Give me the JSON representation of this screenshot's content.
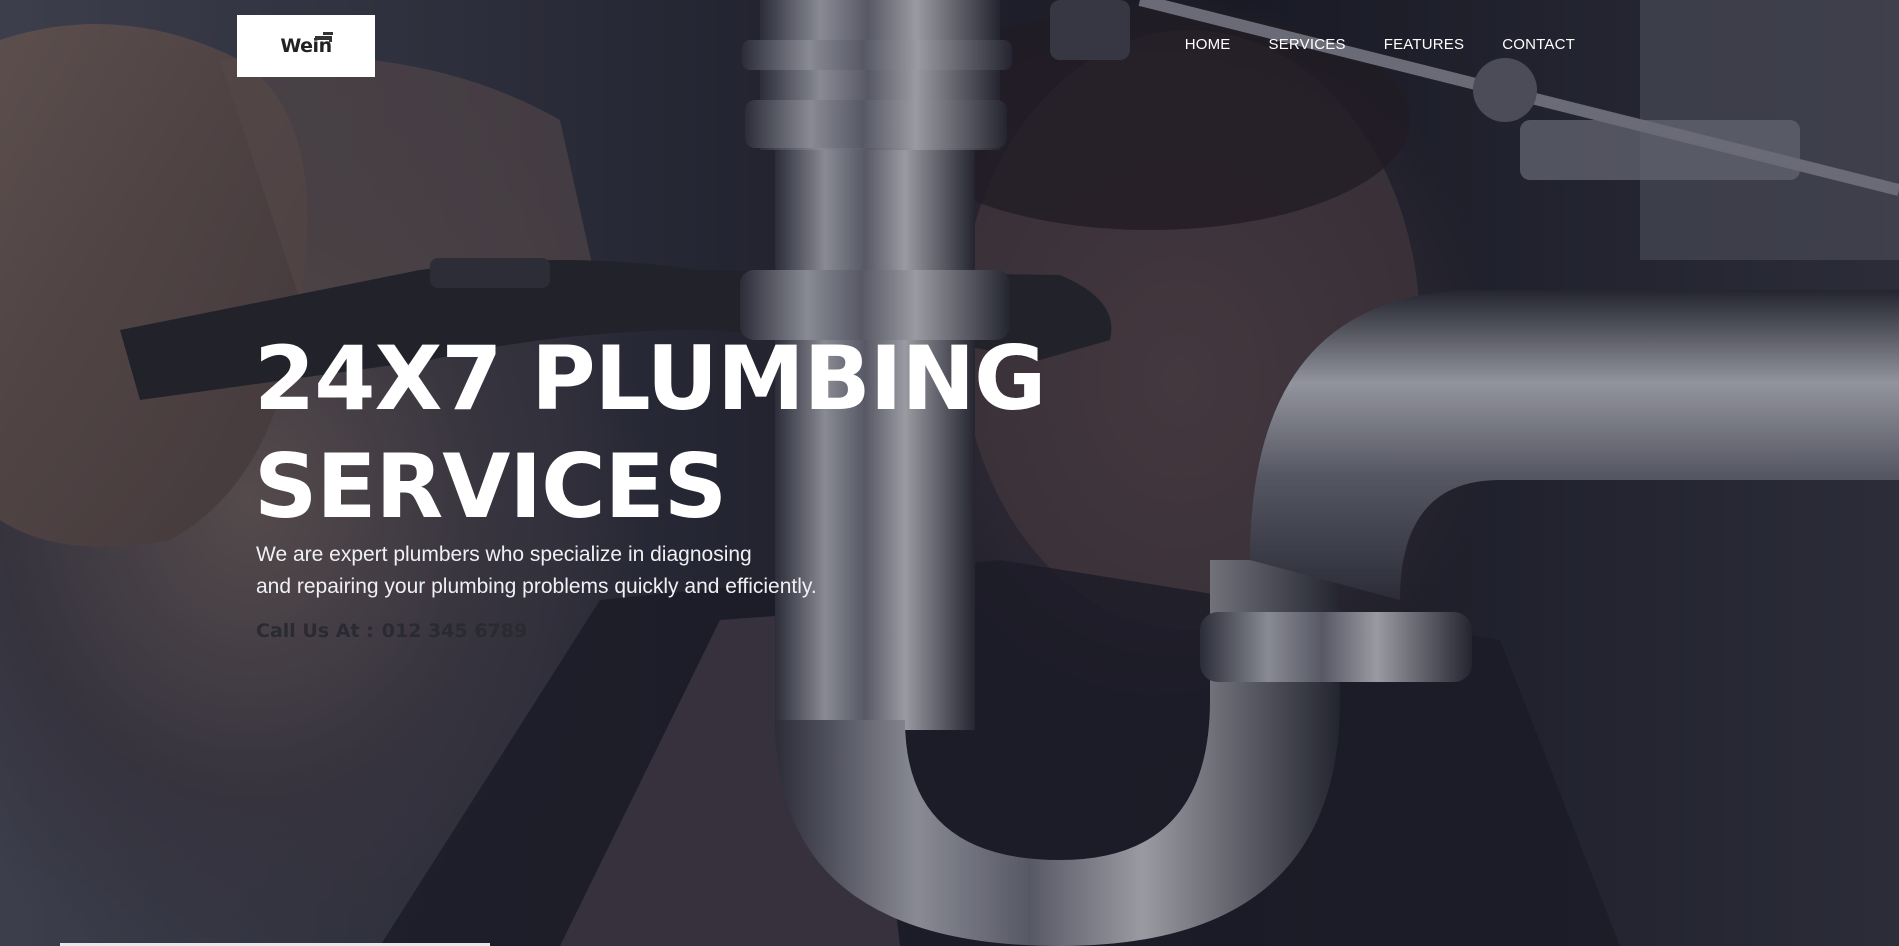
{
  "header": {
    "logo_text": "Wein",
    "nav": [
      {
        "label": "HOME"
      },
      {
        "label": "SERVICES"
      },
      {
        "label": "FEATURES"
      },
      {
        "label": "CONTACT"
      }
    ]
  },
  "hero": {
    "title_line1": "24X7 PLUMBING",
    "title_line2": "SERVICES",
    "subtitle_line1": "We are expert plumbers who specialize in diagnosing",
    "subtitle_line2": "and repairing your plumbing problems quickly and efficiently.",
    "call_label": "Call Us At :",
    "call_number": "012 345 6789"
  },
  "colors": {
    "nav_text": "#ffffff",
    "title_text": "#ffffff",
    "call_text": "#2a2a33",
    "logo_bg": "#ffffff"
  }
}
